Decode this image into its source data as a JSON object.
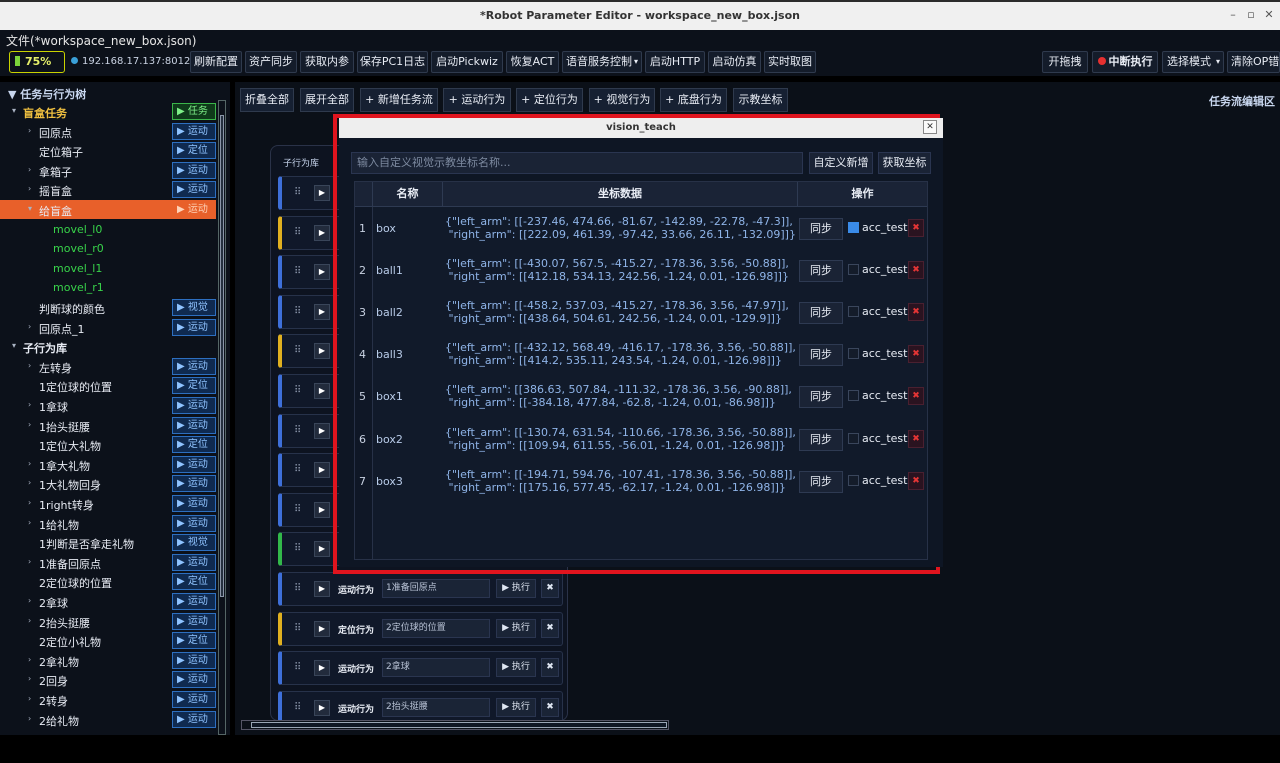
{
  "window": {
    "title": "*Robot Parameter Editor - workspace_new_box.json"
  },
  "menu": {
    "file_label": "文件(*workspace_new_box.json)"
  },
  "toolbar": {
    "battery": "75%",
    "ip": "192.168.17.137:8012",
    "buttons": [
      "刷新配置",
      "资产同步",
      "获取内参",
      "保存PC1日志",
      "启动Pickwiz",
      "恢复ACT",
      "语音服务控制",
      "启动HTTP",
      "启动仿真",
      "实时取图"
    ],
    "right_buttons": [
      "开拖拽",
      "中断执行",
      "选择模式",
      "清除OP错"
    ]
  },
  "tree": {
    "header": "▼ 任务与行为树",
    "rows": [
      {
        "label": "盲盒任务",
        "tag": "▶ 任务",
        "indent": 1,
        "arrow": "▾",
        "style": "gold",
        "tagStyle": "green"
      },
      {
        "label": "回原点",
        "tag": "▶ 运动",
        "indent": 2,
        "arrow": "›"
      },
      {
        "label": "定位箱子",
        "tag": "▶ 定位",
        "indent": 2,
        "arrow": ""
      },
      {
        "label": "拿箱子",
        "tag": "▶ 运动",
        "indent": 2,
        "arrow": "›"
      },
      {
        "label": "摇盲盒",
        "tag": "▶ 运动",
        "indent": 2,
        "arrow": "›"
      },
      {
        "label": "给盲盒",
        "tag": "▶ 运动",
        "indent": 2,
        "arrow": "▾",
        "selected": true
      },
      {
        "label": "movel_l0",
        "tag": "",
        "indent": 3,
        "arrow": "",
        "style": "green"
      },
      {
        "label": "movel_r0",
        "tag": "",
        "indent": 3,
        "arrow": "",
        "style": "green"
      },
      {
        "label": "movel_l1",
        "tag": "",
        "indent": 3,
        "arrow": "",
        "style": "green"
      },
      {
        "label": "movel_r1",
        "tag": "",
        "indent": 3,
        "arrow": "",
        "style": "green"
      },
      {
        "label": "判断球的颜色",
        "tag": "▶ 视觉",
        "indent": 2,
        "arrow": ""
      },
      {
        "label": "回原点_1",
        "tag": "▶ 运动",
        "indent": 2,
        "arrow": "›"
      },
      {
        "label": "子行为库",
        "tag": "",
        "indent": 1,
        "arrow": "▾",
        "style": "sec"
      },
      {
        "label": "左转身",
        "tag": "▶ 运动",
        "indent": 2,
        "arrow": "›"
      },
      {
        "label": "1定位球的位置",
        "tag": "▶ 定位",
        "indent": 2,
        "arrow": ""
      },
      {
        "label": "1拿球",
        "tag": "▶ 运动",
        "indent": 2,
        "arrow": "›"
      },
      {
        "label": "1抬头挺腰",
        "tag": "▶ 运动",
        "indent": 2,
        "arrow": "›"
      },
      {
        "label": "1定位大礼物",
        "tag": "▶ 定位",
        "indent": 2,
        "arrow": ""
      },
      {
        "label": "1拿大礼物",
        "tag": "▶ 运动",
        "indent": 2,
        "arrow": "›"
      },
      {
        "label": "1大礼物回身",
        "tag": "▶ 运动",
        "indent": 2,
        "arrow": "›"
      },
      {
        "label": "1right转身",
        "tag": "▶ 运动",
        "indent": 2,
        "arrow": "›"
      },
      {
        "label": "1给礼物",
        "tag": "▶ 运动",
        "indent": 2,
        "arrow": "›"
      },
      {
        "label": "1判断是否拿走礼物",
        "tag": "▶ 视觉",
        "indent": 2,
        "arrow": ""
      },
      {
        "label": "1准备回原点",
        "tag": "▶ 运动",
        "indent": 2,
        "arrow": "›"
      },
      {
        "label": "2定位球的位置",
        "tag": "▶ 定位",
        "indent": 2,
        "arrow": ""
      },
      {
        "label": "2拿球",
        "tag": "▶ 运动",
        "indent": 2,
        "arrow": "›"
      },
      {
        "label": "2抬头挺腰",
        "tag": "▶ 运动",
        "indent": 2,
        "arrow": "›"
      },
      {
        "label": "2定位小礼物",
        "tag": "▶ 定位",
        "indent": 2,
        "arrow": ""
      },
      {
        "label": "2拿礼物",
        "tag": "▶ 运动",
        "indent": 2,
        "arrow": "›"
      },
      {
        "label": "2回身",
        "tag": "▶ 运动",
        "indent": 2,
        "arrow": "›"
      },
      {
        "label": "2转身",
        "tag": "▶ 运动",
        "indent": 2,
        "arrow": "›"
      },
      {
        "label": "2给礼物",
        "tag": "▶ 运动",
        "indent": 2,
        "arrow": "›"
      }
    ]
  },
  "main": {
    "actions": [
      "折叠全部",
      "展开全部",
      "+ 新增任务流",
      "+ 运动行为",
      "+ 定位行为",
      "+ 视觉行为",
      "+ 底盘行为",
      "示教坐标"
    ],
    "flow_area_label": "任务流编辑区",
    "panel_title": "子行为库",
    "cards": [
      {
        "color": "blue",
        "type": "",
        "name": ""
      },
      {
        "color": "yellow",
        "type": "",
        "name": ""
      },
      {
        "color": "blue",
        "type": "",
        "name": ""
      },
      {
        "color": "blue",
        "type": "",
        "name": ""
      },
      {
        "color": "yellow",
        "type": "",
        "name": ""
      },
      {
        "color": "blue",
        "type": "",
        "name": ""
      },
      {
        "color": "blue",
        "type": "",
        "name": ""
      },
      {
        "color": "blue",
        "type": "",
        "name": ""
      },
      {
        "color": "blue",
        "type": "",
        "name": ""
      },
      {
        "color": "green",
        "type": "",
        "name": ""
      },
      {
        "color": "blue",
        "type": "运动行为",
        "name": "1准备回原点"
      },
      {
        "color": "yellow",
        "type": "定位行为",
        "name": "2定位球的位置"
      },
      {
        "color": "blue",
        "type": "运动行为",
        "name": "2拿球"
      },
      {
        "color": "blue",
        "type": "运动行为",
        "name": "2抬头挺腰"
      }
    ],
    "exec_label": "▶ 执行",
    "delete_label": "✖"
  },
  "dialog": {
    "title": "vision_teach",
    "search_placeholder": "输入自定义视觉示教坐标名称...",
    "add_button": "自定义新增",
    "get_button": "获取坐标",
    "columns": [
      "名称",
      "坐标数据",
      "操作"
    ],
    "sync_label": "同步",
    "acc_label": "acc_test",
    "rows": [
      {
        "num": "1",
        "name": "box",
        "line1": "{\"left_arm\": [[-237.46, 474.66, -81.67, -142.89, -22.78, -47.3]],",
        "line2": " \"right_arm\": [[222.09, 461.39, -97.42, 33.66, 26.11, -132.09]]}",
        "checked": true
      },
      {
        "num": "2",
        "name": "ball1",
        "line1": "{\"left_arm\": [[-430.07, 567.5, -415.27, -178.36, 3.56, -50.88]],",
        "line2": " \"right_arm\": [[412.18, 534.13, 242.56, -1.24, 0.01, -126.98]]}",
        "checked": false
      },
      {
        "num": "3",
        "name": "ball2",
        "line1": "{\"left_arm\": [[-458.2, 537.03, -415.27, -178.36, 3.56, -47.97]],",
        "line2": " \"right_arm\": [[438.64, 504.61, 242.56, -1.24, 0.01, -129.9]]}",
        "checked": false
      },
      {
        "num": "4",
        "name": "ball3",
        "line1": "{\"left_arm\": [[-432.12, 568.49, -416.17, -178.36, 3.56, -50.88]],",
        "line2": " \"right_arm\": [[414.2, 535.11, 243.54, -1.24, 0.01, -126.98]]}",
        "checked": false
      },
      {
        "num": "5",
        "name": "box1",
        "line1": "{\"left_arm\": [[386.63, 507.84, -111.32, -178.36, 3.56, -90.88]],",
        "line2": " \"right_arm\": [[-384.18, 477.84, -62.8, -1.24, 0.01, -86.98]]}",
        "checked": false
      },
      {
        "num": "6",
        "name": "box2",
        "line1": "{\"left_arm\": [[-130.74, 631.54, -110.66, -178.36, 3.56, -50.88]],",
        "line2": " \"right_arm\": [[109.94, 611.55, -56.01, -1.24, 0.01, -126.98]]}",
        "checked": false
      },
      {
        "num": "7",
        "name": "box3",
        "line1": "{\"left_arm\": [[-194.71, 594.76, -107.41, -178.36, 3.56, -50.88]],",
        "line2": " \"right_arm\": [[175.16, 577.45, -62.17, -1.24, 0.01, -126.98]]}",
        "checked": false
      }
    ]
  }
}
